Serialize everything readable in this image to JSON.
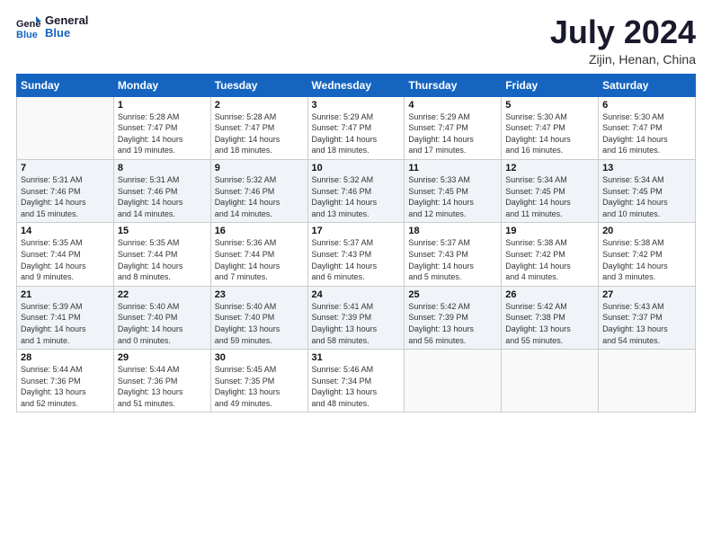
{
  "logo": {
    "line1": "General",
    "line2": "Blue"
  },
  "title": "July 2024",
  "subtitle": "Zijin, Henan, China",
  "headers": [
    "Sunday",
    "Monday",
    "Tuesday",
    "Wednesday",
    "Thursday",
    "Friday",
    "Saturday"
  ],
  "weeks": [
    [
      {
        "num": "",
        "info": ""
      },
      {
        "num": "1",
        "info": "Sunrise: 5:28 AM\nSunset: 7:47 PM\nDaylight: 14 hours\nand 19 minutes."
      },
      {
        "num": "2",
        "info": "Sunrise: 5:28 AM\nSunset: 7:47 PM\nDaylight: 14 hours\nand 18 minutes."
      },
      {
        "num": "3",
        "info": "Sunrise: 5:29 AM\nSunset: 7:47 PM\nDaylight: 14 hours\nand 18 minutes."
      },
      {
        "num": "4",
        "info": "Sunrise: 5:29 AM\nSunset: 7:47 PM\nDaylight: 14 hours\nand 17 minutes."
      },
      {
        "num": "5",
        "info": "Sunrise: 5:30 AM\nSunset: 7:47 PM\nDaylight: 14 hours\nand 16 minutes."
      },
      {
        "num": "6",
        "info": "Sunrise: 5:30 AM\nSunset: 7:47 PM\nDaylight: 14 hours\nand 16 minutes."
      }
    ],
    [
      {
        "num": "7",
        "info": "Sunrise: 5:31 AM\nSunset: 7:46 PM\nDaylight: 14 hours\nand 15 minutes."
      },
      {
        "num": "8",
        "info": "Sunrise: 5:31 AM\nSunset: 7:46 PM\nDaylight: 14 hours\nand 14 minutes."
      },
      {
        "num": "9",
        "info": "Sunrise: 5:32 AM\nSunset: 7:46 PM\nDaylight: 14 hours\nand 14 minutes."
      },
      {
        "num": "10",
        "info": "Sunrise: 5:32 AM\nSunset: 7:46 PM\nDaylight: 14 hours\nand 13 minutes."
      },
      {
        "num": "11",
        "info": "Sunrise: 5:33 AM\nSunset: 7:45 PM\nDaylight: 14 hours\nand 12 minutes."
      },
      {
        "num": "12",
        "info": "Sunrise: 5:34 AM\nSunset: 7:45 PM\nDaylight: 14 hours\nand 11 minutes."
      },
      {
        "num": "13",
        "info": "Sunrise: 5:34 AM\nSunset: 7:45 PM\nDaylight: 14 hours\nand 10 minutes."
      }
    ],
    [
      {
        "num": "14",
        "info": "Sunrise: 5:35 AM\nSunset: 7:44 PM\nDaylight: 14 hours\nand 9 minutes."
      },
      {
        "num": "15",
        "info": "Sunrise: 5:35 AM\nSunset: 7:44 PM\nDaylight: 14 hours\nand 8 minutes."
      },
      {
        "num": "16",
        "info": "Sunrise: 5:36 AM\nSunset: 7:44 PM\nDaylight: 14 hours\nand 7 minutes."
      },
      {
        "num": "17",
        "info": "Sunrise: 5:37 AM\nSunset: 7:43 PM\nDaylight: 14 hours\nand 6 minutes."
      },
      {
        "num": "18",
        "info": "Sunrise: 5:37 AM\nSunset: 7:43 PM\nDaylight: 14 hours\nand 5 minutes."
      },
      {
        "num": "19",
        "info": "Sunrise: 5:38 AM\nSunset: 7:42 PM\nDaylight: 14 hours\nand 4 minutes."
      },
      {
        "num": "20",
        "info": "Sunrise: 5:38 AM\nSunset: 7:42 PM\nDaylight: 14 hours\nand 3 minutes."
      }
    ],
    [
      {
        "num": "21",
        "info": "Sunrise: 5:39 AM\nSunset: 7:41 PM\nDaylight: 14 hours\nand 1 minute."
      },
      {
        "num": "22",
        "info": "Sunrise: 5:40 AM\nSunset: 7:40 PM\nDaylight: 14 hours\nand 0 minutes."
      },
      {
        "num": "23",
        "info": "Sunrise: 5:40 AM\nSunset: 7:40 PM\nDaylight: 13 hours\nand 59 minutes."
      },
      {
        "num": "24",
        "info": "Sunrise: 5:41 AM\nSunset: 7:39 PM\nDaylight: 13 hours\nand 58 minutes."
      },
      {
        "num": "25",
        "info": "Sunrise: 5:42 AM\nSunset: 7:39 PM\nDaylight: 13 hours\nand 56 minutes."
      },
      {
        "num": "26",
        "info": "Sunrise: 5:42 AM\nSunset: 7:38 PM\nDaylight: 13 hours\nand 55 minutes."
      },
      {
        "num": "27",
        "info": "Sunrise: 5:43 AM\nSunset: 7:37 PM\nDaylight: 13 hours\nand 54 minutes."
      }
    ],
    [
      {
        "num": "28",
        "info": "Sunrise: 5:44 AM\nSunset: 7:36 PM\nDaylight: 13 hours\nand 52 minutes."
      },
      {
        "num": "29",
        "info": "Sunrise: 5:44 AM\nSunset: 7:36 PM\nDaylight: 13 hours\nand 51 minutes."
      },
      {
        "num": "30",
        "info": "Sunrise: 5:45 AM\nSunset: 7:35 PM\nDaylight: 13 hours\nand 49 minutes."
      },
      {
        "num": "31",
        "info": "Sunrise: 5:46 AM\nSunset: 7:34 PM\nDaylight: 13 hours\nand 48 minutes."
      },
      {
        "num": "",
        "info": ""
      },
      {
        "num": "",
        "info": ""
      },
      {
        "num": "",
        "info": ""
      }
    ]
  ]
}
